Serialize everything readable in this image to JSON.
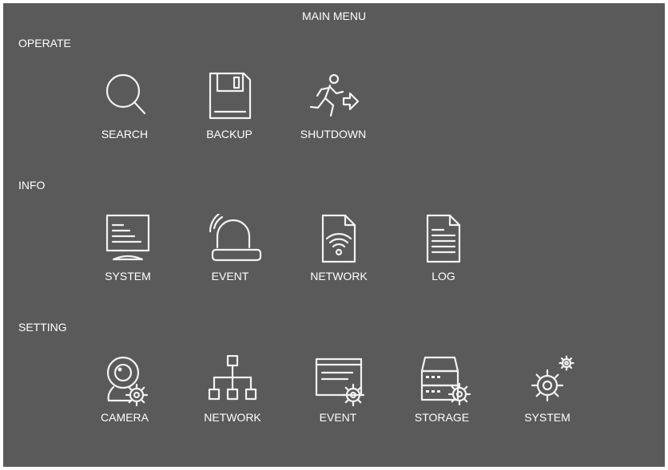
{
  "title": "MAIN MENU",
  "sections": {
    "operate": {
      "label": "OPERATE",
      "items": [
        {
          "label": "SEARCH",
          "icon": "magnifier-icon"
        },
        {
          "label": "BACKUP",
          "icon": "floppy-disk-icon"
        },
        {
          "label": "SHUTDOWN",
          "icon": "running-exit-icon"
        }
      ]
    },
    "info": {
      "label": "INFO",
      "items": [
        {
          "label": "SYSTEM",
          "icon": "monitor-icon"
        },
        {
          "label": "EVENT",
          "icon": "alarm-siren-icon"
        },
        {
          "label": "NETWORK",
          "icon": "network-file-icon"
        },
        {
          "label": "LOG",
          "icon": "log-document-icon"
        }
      ]
    },
    "setting": {
      "label": "SETTING",
      "items": [
        {
          "label": "CAMERA",
          "icon": "camera-settings-icon"
        },
        {
          "label": "NETWORK",
          "icon": "network-tree-icon"
        },
        {
          "label": "EVENT",
          "icon": "event-settings-icon"
        },
        {
          "label": "STORAGE",
          "icon": "storage-settings-icon"
        },
        {
          "label": "SYSTEM",
          "icon": "system-gears-icon"
        }
      ]
    }
  },
  "colors": {
    "panel": "#5a5a5a",
    "text": "#ffffff",
    "icon": "#f2f2f2"
  }
}
